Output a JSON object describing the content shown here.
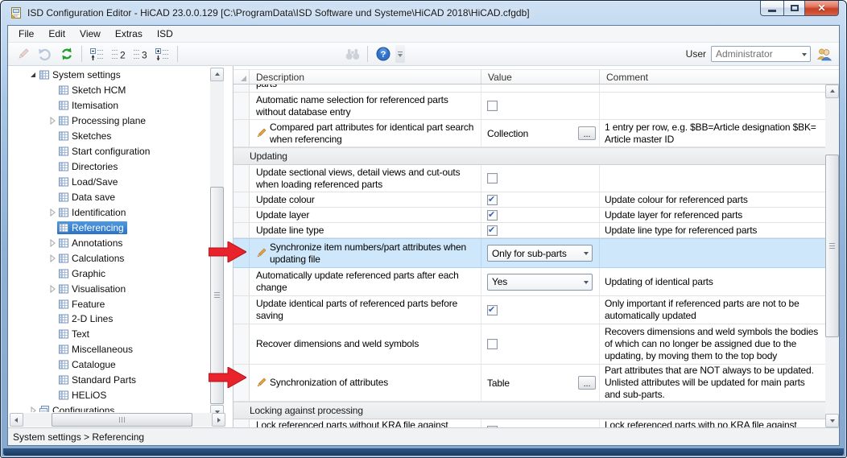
{
  "window": {
    "title": "ISD Configuration Editor  - HiCAD 23.0.0.129 [C:\\ProgramData\\ISD Software und Systeme\\HiCAD 2018\\HiCAD.cfgdb]",
    "app_icon": "isd-configuration-editor-app-icon",
    "controls": [
      "minimize",
      "maximize",
      "close"
    ]
  },
  "menubar": {
    "items": [
      "File",
      "Edit",
      "View",
      "Extras",
      "ISD"
    ]
  },
  "toolbar": {
    "icons": [
      "pencil-edit-icon",
      "undo-icon",
      "refresh-icon",
      "tree-collapse-all-icon",
      "tree-expand-level-2-icon",
      "tree-expand-level-3-icon",
      "tree-expand-all-icon",
      "find-binoculars-icon",
      "help-icon",
      "toolbar-overflow-icon",
      "user-switch-icon"
    ],
    "user": {
      "label": "User",
      "value": "Administrator"
    }
  },
  "tree": {
    "items": [
      {
        "label": "System settings",
        "level": 0,
        "expander": "expanded",
        "icon": "table-grid",
        "selected": false
      },
      {
        "label": "Sketch HCM",
        "level": 1,
        "expander": null,
        "icon": "table-grid",
        "selected": false
      },
      {
        "label": "Itemisation",
        "level": 1,
        "expander": null,
        "icon": "table-grid",
        "selected": false
      },
      {
        "label": "Processing plane",
        "level": 1,
        "expander": "collapsed",
        "icon": "table-grid",
        "selected": false
      },
      {
        "label": "Sketches",
        "level": 1,
        "expander": null,
        "icon": "table-grid",
        "selected": false
      },
      {
        "label": "Start configuration",
        "level": 1,
        "expander": null,
        "icon": "table-grid",
        "selected": false
      },
      {
        "label": "Directories",
        "level": 1,
        "expander": null,
        "icon": "table-grid",
        "selected": false
      },
      {
        "label": "Load/Save",
        "level": 1,
        "expander": null,
        "icon": "table-grid",
        "selected": false
      },
      {
        "label": "Data save",
        "level": 1,
        "expander": null,
        "icon": "table-grid",
        "selected": false
      },
      {
        "label": "Identification",
        "level": 1,
        "expander": "collapsed",
        "icon": "table-grid",
        "selected": false
      },
      {
        "label": "Referencing",
        "level": 1,
        "expander": null,
        "icon": "table-grid",
        "selected": true
      },
      {
        "label": "Annotations",
        "level": 1,
        "expander": "collapsed",
        "icon": "table-grid",
        "selected": false
      },
      {
        "label": "Calculations",
        "level": 1,
        "expander": "collapsed",
        "icon": "table-grid",
        "selected": false
      },
      {
        "label": "Graphic",
        "level": 1,
        "expander": null,
        "icon": "table-grid",
        "selected": false
      },
      {
        "label": "Visualisation",
        "level": 1,
        "expander": "collapsed",
        "icon": "table-grid",
        "selected": false
      },
      {
        "label": "Feature",
        "level": 1,
        "expander": null,
        "icon": "table-grid",
        "selected": false
      },
      {
        "label": "2-D Lines",
        "level": 1,
        "expander": null,
        "icon": "table-grid",
        "selected": false
      },
      {
        "label": "Text",
        "level": 1,
        "expander": null,
        "icon": "table-grid",
        "selected": false
      },
      {
        "label": "Miscellaneous",
        "level": 1,
        "expander": null,
        "icon": "table-grid",
        "selected": false
      },
      {
        "label": "Catalogue",
        "level": 1,
        "expander": null,
        "icon": "table-grid",
        "selected": false
      },
      {
        "label": "Standard Parts",
        "level": 1,
        "expander": null,
        "icon": "table-grid",
        "selected": false
      },
      {
        "label": "HELiOS",
        "level": 1,
        "expander": null,
        "icon": "table-grid",
        "selected": false
      },
      {
        "label": "Configurations",
        "level": 0,
        "expander": "collapsed",
        "icon": "stacked-pages",
        "selected": false
      }
    ]
  },
  "table": {
    "columns": [
      "Description",
      "Value",
      "Comment"
    ],
    "ellipsis_label": "...",
    "rows": [
      {
        "type": "row",
        "desc": "parts",
        "value": null,
        "comment": "",
        "editable": false,
        "selected": false
      },
      {
        "type": "row",
        "desc": "Automatic name selection for referenced parts without database entry",
        "value": {
          "kind": "checkbox",
          "checked": false
        },
        "comment": "",
        "editable": false,
        "selected": false
      },
      {
        "type": "row",
        "desc": "Compared part attributes for identical part search when referencing",
        "value": {
          "kind": "collection",
          "label": "Collection"
        },
        "comment": "1 entry per row, e.g. $BB=Article designation $BK= Article master ID",
        "editable": true,
        "selected": false
      },
      {
        "type": "section",
        "desc": "Updating"
      },
      {
        "type": "row",
        "desc": "Update sectional views, detail views and cut-outs when loading referenced parts",
        "value": {
          "kind": "checkbox",
          "checked": false
        },
        "comment": "",
        "editable": false,
        "selected": false
      },
      {
        "type": "row",
        "desc": "Update colour",
        "value": {
          "kind": "checkbox",
          "checked": true
        },
        "comment": "Update colour for referenced parts",
        "editable": false,
        "selected": false
      },
      {
        "type": "row",
        "desc": "Update layer",
        "value": {
          "kind": "checkbox",
          "checked": true
        },
        "comment": "Update layer for referenced parts",
        "editable": false,
        "selected": false
      },
      {
        "type": "row",
        "desc": "Update line type",
        "value": {
          "kind": "checkbox",
          "checked": true
        },
        "comment": "Update line type for referenced parts",
        "editable": false,
        "selected": false
      },
      {
        "type": "row",
        "desc": "Synchronize item numbers/part attributes when updating file",
        "value": {
          "kind": "dropdown",
          "label": "Only for sub-parts"
        },
        "comment": "",
        "editable": true,
        "selected": true
      },
      {
        "type": "row",
        "desc": "Automatically update referenced parts after each change",
        "value": {
          "kind": "dropdown",
          "label": "Yes"
        },
        "comment": "Updating of identical parts",
        "editable": false,
        "selected": false
      },
      {
        "type": "row",
        "desc": "Update identical parts of referenced parts before saving",
        "value": {
          "kind": "checkbox",
          "checked": true
        },
        "comment": "Only important if referenced parts are not to be automatically updated",
        "editable": false,
        "selected": false
      },
      {
        "type": "row",
        "desc": "Recover dimensions and weld symbols",
        "value": {
          "kind": "checkbox",
          "checked": false
        },
        "comment": "Recovers dimensions and weld symbols the bodies of which can no longer be assigned due to the updating, by moving them to the top body",
        "editable": false,
        "selected": false
      },
      {
        "type": "row",
        "desc": "Synchronization of attributes",
        "value": {
          "kind": "collection",
          "label": "Table"
        },
        "comment": "Part attributes that are NOT always to be updated. Unlisted attributes will be updated for main parts and sub-parts.",
        "editable": true,
        "selected": false
      },
      {
        "type": "section",
        "desc": "Locking against processing"
      },
      {
        "type": "row",
        "desc": "Lock referenced parts without KRA file against processing (Part Manager)",
        "value": {
          "kind": "checkbox",
          "checked": false
        },
        "comment": "Lock referenced parts with no KRA file against processing? (Part Manager)",
        "editable": false,
        "selected": false
      }
    ]
  },
  "annotations": {
    "arrows": [
      {
        "color": "#e8232b",
        "points_to": "Synchronize item numbers/part attributes when updating file"
      },
      {
        "color": "#e8232b",
        "points_to": "Synchronization of attributes"
      }
    ]
  },
  "statusbar": {
    "text": "System settings > Referencing"
  },
  "colors": {
    "frame_blue": "#8fb2d6",
    "selection_blue": "#3a82d2",
    "selected_row_blue": "#cfe7fb",
    "arrow_red": "#e8232b",
    "close_button_red": "#c93f28",
    "refresh_green": "#1fa02e"
  }
}
